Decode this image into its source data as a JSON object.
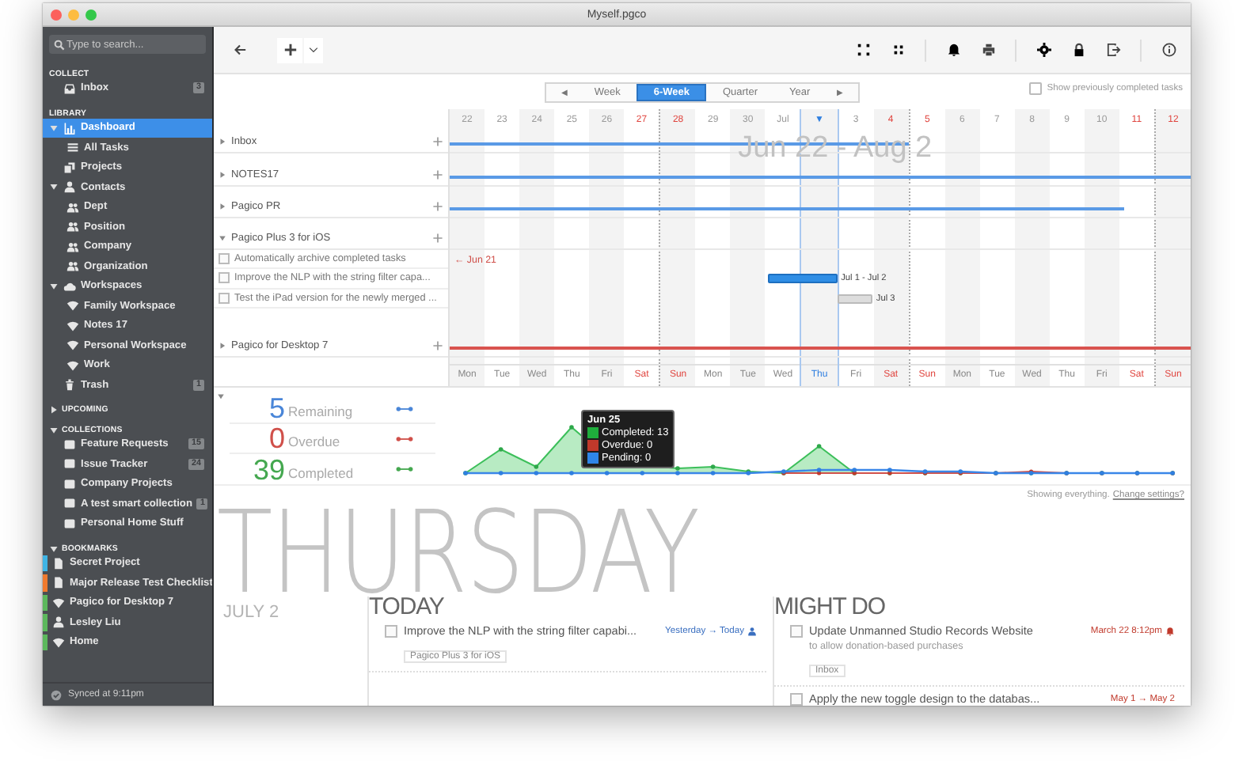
{
  "window": {
    "title": "Myself.pgco"
  },
  "sidebar": {
    "search": {
      "placeholder": "Type to search..."
    },
    "sections": [
      {
        "title": "COLLECT",
        "kind": "fixed",
        "items": [
          {
            "label": "Inbox",
            "badge": "3",
            "selected": false
          }
        ]
      },
      {
        "title": "LIBRARY",
        "kind": "fixed",
        "items": [
          {
            "label": "Dashboard",
            "selected": true,
            "expanded": true,
            "children": [
              {
                "label": "All Tasks",
                "selected": false
              }
            ]
          },
          {
            "label": "Projects",
            "selected": false
          },
          {
            "label": "Contacts",
            "selected": false,
            "expanded": true,
            "children": [
              {
                "label": "Dept",
                "selected": false
              },
              {
                "label": "Position",
                "selected": false
              },
              {
                "label": "Company",
                "selected": false
              },
              {
                "label": "Organization",
                "selected": false
              }
            ]
          },
          {
            "label": "Workspaces",
            "selected": false,
            "expanded": true,
            "children": [
              {
                "label": "Family Workspace",
                "selected": false
              },
              {
                "label": "Notes 17",
                "selected": false
              },
              {
                "label": "Personal Workspace",
                "selected": false
              },
              {
                "label": "Work",
                "selected": false
              }
            ]
          },
          {
            "label": "Trash",
            "badge": "1",
            "selected": false
          }
        ]
      },
      {
        "title": "UPCOMING",
        "kind": "toggle",
        "expanded": false
      },
      {
        "title": "COLLECTIONS",
        "kind": "toggle",
        "expanded": true,
        "items": [
          {
            "label": "Feature Requests",
            "badge": "15",
            "selected": false
          },
          {
            "label": "Issue Tracker",
            "badge": "24",
            "selected": false
          },
          {
            "label": "Company Projects",
            "selected": false
          },
          {
            "label": "A test smart collection",
            "badge": "1",
            "selected": false
          },
          {
            "label": "Personal Home Stuff",
            "selected": false
          }
        ]
      },
      {
        "title": "BOOKMARKS",
        "kind": "toggle",
        "expanded": true,
        "items": [
          {
            "label": "Secret Project",
            "color": "#3fb4e5",
            "selected": false
          },
          {
            "label": "Major Release Test Checklist",
            "color": "#f07a2e",
            "selected": false
          },
          {
            "label": "Pagico for Desktop 7",
            "color": "#5cb85c",
            "selected": false
          },
          {
            "label": "Lesley Liu",
            "color": "#5cb85c",
            "selected": false
          },
          {
            "label": "Home",
            "color": "#5cb85c",
            "selected": false
          }
        ]
      }
    ],
    "status": "Synced at 9:11pm"
  },
  "view_switch": {
    "prev": "◀",
    "next": "▶",
    "options": [
      {
        "label": "Week",
        "selected": false
      },
      {
        "label": "6-Week",
        "selected": true
      },
      {
        "label": "Quarter",
        "selected": false
      },
      {
        "label": "Year",
        "selected": false
      }
    ],
    "show_completed": {
      "label": "Show previously completed tasks",
      "checked": false
    }
  },
  "timeline": {
    "range_label": "Jun 22 - Aug 2",
    "days": [
      {
        "date": "22",
        "weekday": "Mon",
        "weekend": false,
        "today": false
      },
      {
        "date": "23",
        "weekday": "Tue",
        "weekend": false,
        "today": false
      },
      {
        "date": "24",
        "weekday": "Wed",
        "weekend": false,
        "today": false
      },
      {
        "date": "25",
        "weekday": "Thu",
        "weekend": false,
        "today": false
      },
      {
        "date": "26",
        "weekday": "Fri",
        "weekend": false,
        "today": false
      },
      {
        "date": "27",
        "weekday": "Sat",
        "weekend": true,
        "today": false
      },
      {
        "date": "28",
        "weekday": "Sun",
        "weekend": true,
        "today": false
      },
      {
        "date": "29",
        "weekday": "Mon",
        "weekend": false,
        "today": false
      },
      {
        "date": "30",
        "weekday": "Tue",
        "weekend": false,
        "today": false
      },
      {
        "date": "Jul",
        "weekday": "Wed",
        "weekend": false,
        "today": false
      },
      {
        "date": "▼",
        "weekday": "Thu",
        "weekend": false,
        "today": true
      },
      {
        "date": "3",
        "weekday": "Fri",
        "weekend": false,
        "today": false
      },
      {
        "date": "4",
        "weekday": "Sat",
        "weekend": true,
        "today": false
      },
      {
        "date": "5",
        "weekday": "Sun",
        "weekend": true,
        "today": false
      },
      {
        "date": "6",
        "weekday": "Mon",
        "weekend": false,
        "today": false
      },
      {
        "date": "7",
        "weekday": "Tue",
        "weekend": false,
        "today": false
      },
      {
        "date": "8",
        "weekday": "Wed",
        "weekend": false,
        "today": false
      },
      {
        "date": "9",
        "weekday": "Thu",
        "weekend": false,
        "today": false
      },
      {
        "date": "10",
        "weekday": "Fri",
        "weekend": false,
        "today": false
      },
      {
        "date": "11",
        "weekday": "Sat",
        "weekend": true,
        "today": false
      },
      {
        "date": "12",
        "weekday": "Sun",
        "weekend": true,
        "today": false
      }
    ],
    "projects": [
      {
        "title": "Inbox",
        "expanded": false,
        "bar": {
          "level": 0.62,
          "color": "#5a9ae6"
        }
      },
      {
        "title": "NOTES17",
        "expanded": false,
        "bar": {
          "level": 1,
          "color": "#5a9ae6"
        }
      },
      {
        "title": "Pagico PR",
        "expanded": false,
        "bar": {
          "level": 0.91,
          "color": "#5a9ae6"
        }
      },
      {
        "title": "Pagico Plus 3 for iOS",
        "expanded": true,
        "tasks": [
          {
            "title": "Automatically archive completed tasks",
            "checked": false,
            "kind": "overdue",
            "label": "← Jun 21"
          },
          {
            "title": "Improve the NLP with the string filter capa...",
            "checked": false,
            "kind": "bar",
            "label": "Jul 1 - Jul 2"
          },
          {
            "title": "Test the iPad version for the newly merged ...",
            "checked": false,
            "kind": "pending",
            "label": "Jul 3"
          }
        ]
      },
      {
        "title": "Pagico for Desktop 7",
        "expanded": false,
        "bar": {
          "level": 1,
          "color": "#d9534f"
        }
      }
    ]
  },
  "summary": {
    "expanded": true,
    "items": [
      {
        "count": "5",
        "caption": "Remaining",
        "color": "#4a86d8"
      },
      {
        "count": "0",
        "caption": "Overdue",
        "color": "#d0504a"
      },
      {
        "count": "39",
        "caption": "Completed",
        "color": "#45a850"
      }
    ],
    "tooltip": {
      "title": "Jun 25",
      "entries": [
        {
          "label": "Completed: 13",
          "color": "#1fae3c"
        },
        {
          "label": "Overdue: 0",
          "color": "#c0392b"
        },
        {
          "label": "Pending: 0",
          "color": "#2f86e8"
        }
      ]
    }
  },
  "footer": {
    "text": "Showing everything.",
    "link": "Change settings?"
  },
  "day": {
    "weekday": "THURSDAY",
    "date": "JULY 2",
    "lists": [
      {
        "title": "TODAY",
        "tasks": [
          {
            "title": "Improve the NLP with the string filter capabi...",
            "checked": false,
            "when": "Yesterday → Today",
            "color": "#3a6fc0",
            "tag": "Pagico Plus 3 for iOS"
          }
        ]
      },
      {
        "title": "MIGHT DO",
        "tasks": [
          {
            "title": "Update Unmanned Studio Records Website",
            "checked": false,
            "when": "March 22 8:12pm",
            "color": "#c0392b",
            "note": "to allow donation-based purchases",
            "tag": "Inbox"
          },
          {
            "title": "Apply the new toggle design to the databas...",
            "checked": false,
            "when": "May 1 → May 2",
            "color": "#c0392b"
          }
        ]
      }
    ]
  }
}
